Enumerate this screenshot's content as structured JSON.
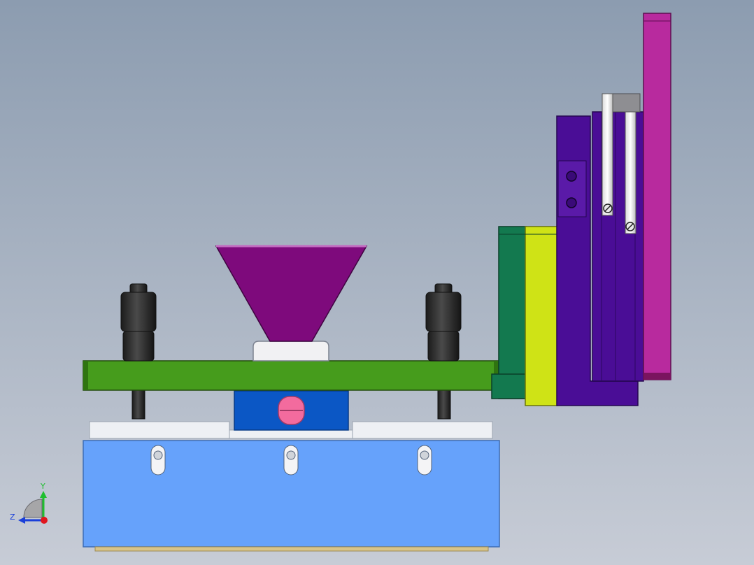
{
  "viewport": {
    "background_top": "#8c9cb0",
    "background_bottom": "#c7ccd6"
  },
  "triad": {
    "y_label": "Y",
    "z_label": "Z",
    "y_color": "#1fbf2f",
    "z_color": "#1a3fd9",
    "x_color": "#e0161e"
  },
  "parts": {
    "base_block": "#66a2fb",
    "slide_rails": "#eef0f4",
    "clamp_block": "#0b57c5",
    "clamp_knob": "#f36b9e",
    "green_plate": "#469c1c",
    "hopper": "#7e0a7c",
    "hopper_seat": "#f1f1f3",
    "guide_post": "#2b2b2b",
    "dark_green_block": "#13794f",
    "yellow_block": "#cfe316",
    "purple_bracket": "#4a0d96",
    "magenta_bar": "#b82a9e",
    "piston_rod": "#f2f2f2"
  }
}
